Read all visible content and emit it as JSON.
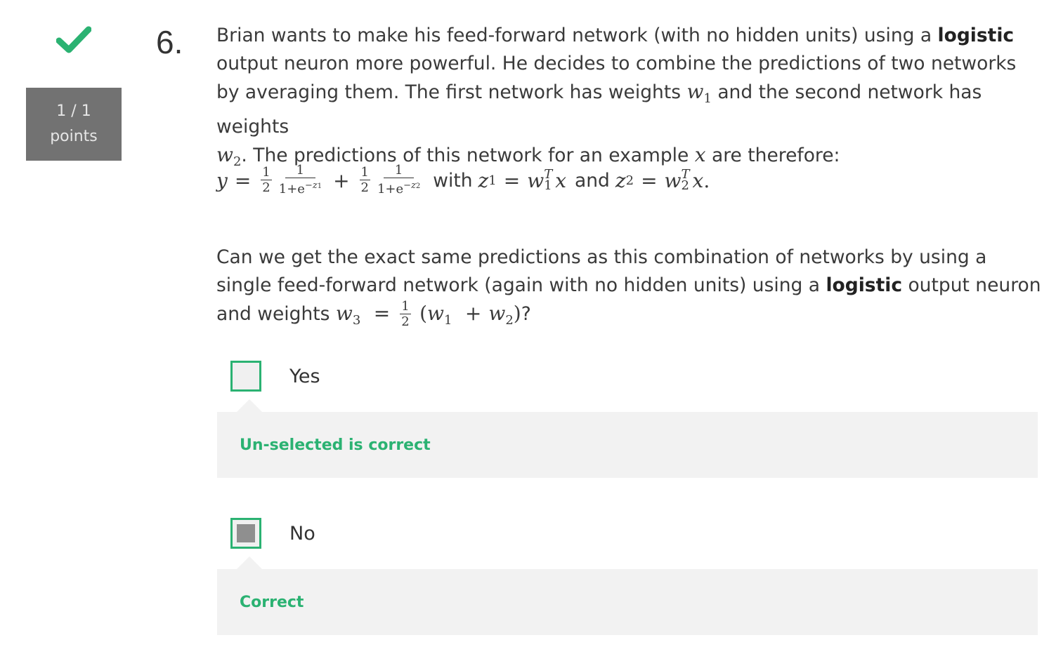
{
  "status": {
    "icon": "checkmark-icon",
    "points_score": "1 / 1",
    "points_label": "points",
    "accent_color": "#2bb272"
  },
  "question": {
    "number": "6.",
    "intro_part1": "Brian wants to make his feed-forward network (with no hidden units) using a ",
    "intro_bold": "logistic",
    "intro_part2": " output neuron more powerful. He decides to combine the predictions of two networks by averaging them. The first network has weights ",
    "w1": "w",
    "w1_sub": "1",
    "intro_part3": " and the second network has weights ",
    "w2": "w",
    "w2_sub": "2",
    "intro_part4": ". The predictions of this network for an example ",
    "x_var": "x",
    "intro_part5": " are therefore:",
    "formula": {
      "y": "y",
      "eq": "=",
      "half_num": "1",
      "half_den": "2",
      "one": "1",
      "den1": "1+e",
      "exp1": "−z",
      "exp1_sub": "1",
      "plus": "+",
      "den2": "1+e",
      "exp2": "−z",
      "exp2_sub": "2",
      "with": "with",
      "z": "z",
      "z1_sub": "1",
      "z2_sub": "2",
      "w": "w",
      "T": "T",
      "x": "x",
      "and": "and",
      "period": "."
    },
    "q2_part1": "Can we get the exact same predictions as this combination of networks by using a single feed-forward network (again with no hidden units) using a ",
    "q2_bold": "logistic",
    "q2_part2": " output neuron and weights ",
    "w3": "w",
    "w3_sub": "3",
    "q2_eq": "=",
    "q2_frac_num": "1",
    "q2_frac_den": "2",
    "q2_paren_open": "(",
    "q2_plus": "+",
    "q2_paren_close": ")",
    "q2_end": "?"
  },
  "options": [
    {
      "label": "Yes",
      "checked": false,
      "feedback": "Un-selected is correct"
    },
    {
      "label": "No",
      "checked": true,
      "feedback": "Correct"
    }
  ]
}
